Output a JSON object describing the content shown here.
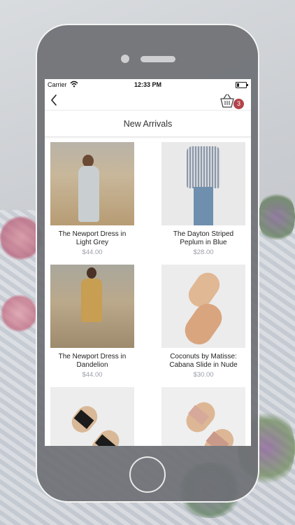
{
  "statusbar": {
    "carrier": "Carrier",
    "time": "12:33 PM"
  },
  "navbar": {
    "cart_count": "3"
  },
  "page": {
    "title": "New Arrivals"
  },
  "products": [
    {
      "name": "The Newport Dress in Light Grey",
      "price": "$44.00"
    },
    {
      "name": "The Dayton Striped Peplum in Blue",
      "price": "$28.00"
    },
    {
      "name": "The Newport Dress in Dandelion",
      "price": "$44.00"
    },
    {
      "name": "Coconuts by Matisse: Cabana Slide in Nude",
      "price": "$30.00"
    },
    {
      "name": "",
      "price": ""
    },
    {
      "name": "",
      "price": ""
    }
  ],
  "colors": {
    "accent_badge": "#b4434b",
    "price_gray": "#9a9ea8"
  }
}
